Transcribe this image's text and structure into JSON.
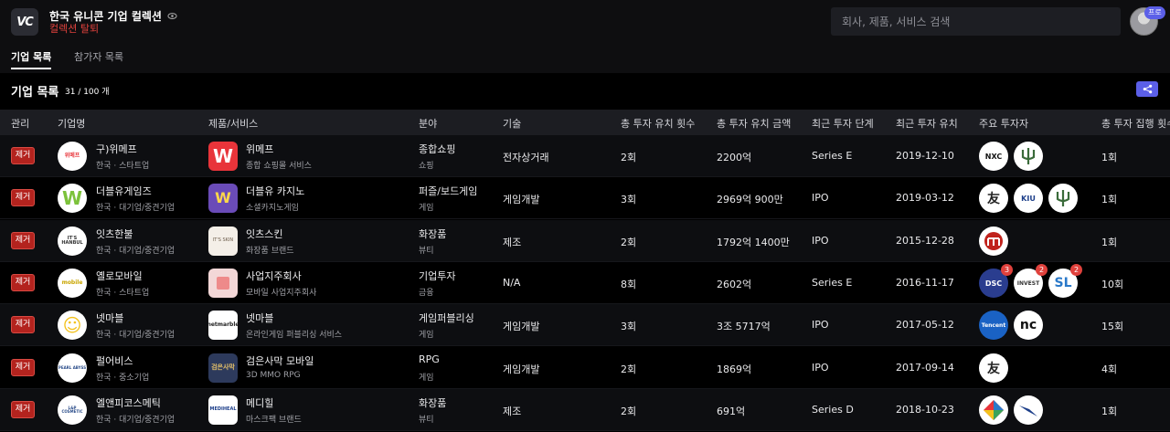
{
  "header": {
    "logo_text": "VC",
    "collection_title": "한국 유니콘 기업 컬렉션",
    "leave_label": "컬렉션 탈퇴",
    "search_placeholder": "회사, 제품, 서비스 검색",
    "pro_badge": "프로"
  },
  "tabs": [
    {
      "label": "기업 목록",
      "active": true
    },
    {
      "label": "참가자 목록",
      "active": false
    }
  ],
  "section": {
    "title": "기업 목록",
    "count": "31 / 100 개"
  },
  "columns": [
    "관리",
    "기업명",
    "제품/서비스",
    "분야",
    "기술",
    "총 투자 유치 횟수",
    "총 투자 유치 금액",
    "최근 투자 단계",
    "최근 투자 유치",
    "주요 투자자",
    "총 투자 집행 횟수"
  ],
  "rows": [
    {
      "remove_label": "제거",
      "company": "구)위메프",
      "company_meta": "한국 · 스타트업",
      "company_logo": "wemakeprice-logo",
      "product": "위메프",
      "product_desc": "종합 쇼핑몰 서비스",
      "product_logo": "wemakeprice-app-icon",
      "product_logo_text": "W",
      "field": "종합쇼핑",
      "field_sub": "쇼핑",
      "tech": "전자상거래",
      "rounds": "2회",
      "amount": "2200억",
      "stage": "Series E",
      "last_date": "2019-12-10",
      "investors": [
        {
          "icon": "nxc-logo",
          "text": "NXC",
          "badge": ""
        },
        {
          "icon": "trident-logo",
          "text": "",
          "badge": ""
        }
      ],
      "exec_count": "1회"
    },
    {
      "remove_label": "제거",
      "company": "더블유게임즈",
      "company_meta": "한국 · 대기업/중견기업",
      "company_logo": "doubleugames-logo",
      "product": "더블유 카지노",
      "product_desc": "소셜카지노게임",
      "product_logo": "doubleu-casino-icon",
      "product_logo_text": "W",
      "field": "퍼즐/보드게임",
      "field_sub": "게임",
      "tech": "게임개발",
      "rounds": "3회",
      "amount": "2969억 900만",
      "stage": "IPO",
      "last_date": "2019-03-12",
      "investors": [
        {
          "icon": "kor-char-logo",
          "text": "友",
          "badge": ""
        },
        {
          "icon": "globe-logo",
          "text": "KIU",
          "badge": ""
        },
        {
          "icon": "trident-logo",
          "text": "",
          "badge": ""
        }
      ],
      "exec_count": "1회"
    },
    {
      "remove_label": "제거",
      "company": "잇츠한불",
      "company_meta": "한국 · 대기업/중견기업",
      "company_logo": "itshanbul-logo",
      "product": "잇츠스킨",
      "product_desc": "화장품 브랜드",
      "product_logo": "itsskin-icon",
      "product_logo_text": "IT'S SKIN",
      "field": "화장품",
      "field_sub": "뷰티",
      "tech": "제조",
      "rounds": "2회",
      "amount": "1792억 1400만",
      "stage": "IPO",
      "last_date": "2015-12-28",
      "investors": [
        {
          "icon": "red-maze-logo",
          "text": "",
          "badge": ""
        }
      ],
      "exec_count": "1회"
    },
    {
      "remove_label": "제거",
      "company": "옐로모바일",
      "company_meta": "한국 · 스타트업",
      "company_logo": "yellowmobile-logo",
      "product": "사업지주회사",
      "product_desc": "모바일 사업지주회사",
      "product_logo": "cube-icon",
      "product_logo_text": "",
      "field": "기업투자",
      "field_sub": "금융",
      "tech": "N/A",
      "rounds": "8회",
      "amount": "2602억",
      "stage": "Series E",
      "last_date": "2016-11-17",
      "investors": [
        {
          "icon": "dsc-logo",
          "text": "DSC",
          "badge": "3"
        },
        {
          "icon": "investor-logo",
          "text": "INVEST",
          "badge": "2"
        },
        {
          "icon": "sl-logo",
          "text": "SL",
          "badge": "2"
        }
      ],
      "exec_count": "10회"
    },
    {
      "remove_label": "제거",
      "company": "넷마블",
      "company_meta": "한국 · 대기업/중견기업",
      "company_logo": "netmarble-logo",
      "product": "넷마블",
      "product_desc": "온라인게임 퍼블리싱 서비스",
      "product_logo": "netmarble-icon",
      "product_logo_text": "netmarble",
      "field": "게임퍼블리싱",
      "field_sub": "게임",
      "tech": "게임개발",
      "rounds": "3회",
      "amount": "3조 5717억",
      "stage": "IPO",
      "last_date": "2017-05-12",
      "investors": [
        {
          "icon": "tencent-logo",
          "text": "Tencent",
          "badge": ""
        },
        {
          "icon": "nc-logo",
          "text": "nc",
          "badge": ""
        }
      ],
      "exec_count": "15회"
    },
    {
      "remove_label": "제거",
      "company": "펄어비스",
      "company_meta": "한국 · 중소기업",
      "company_logo": "pearlabyss-logo",
      "product": "검은사막 모바일",
      "product_desc": "3D MMO RPG",
      "product_logo": "blackdesert-icon",
      "product_logo_text": "검은사막",
      "field": "RPG",
      "field_sub": "게임",
      "tech": "게임개발",
      "rounds": "2회",
      "amount": "1869억",
      "stage": "IPO",
      "last_date": "2017-09-14",
      "investors": [
        {
          "icon": "kor-char-logo",
          "text": "友",
          "badge": ""
        }
      ],
      "exec_count": "4회"
    },
    {
      "remove_label": "제거",
      "company": "엘앤피코스메틱",
      "company_meta": "한국 · 대기업/중견기업",
      "company_logo": "lnpcosmetic-logo",
      "product": "메디힐",
      "product_desc": "마스크팩 브랜드",
      "product_logo": "mediheal-icon",
      "product_logo_text": "MEDIHEAL",
      "field": "화장품",
      "field_sub": "뷰티",
      "tech": "제조",
      "rounds": "2회",
      "amount": "691억",
      "stage": "Series D",
      "last_date": "2018-10-23",
      "investors": [
        {
          "icon": "multicolor-diamond-logo",
          "text": "",
          "badge": ""
        },
        {
          "icon": "bird-logo",
          "text": "",
          "badge": ""
        }
      ],
      "exec_count": "1회"
    }
  ]
}
